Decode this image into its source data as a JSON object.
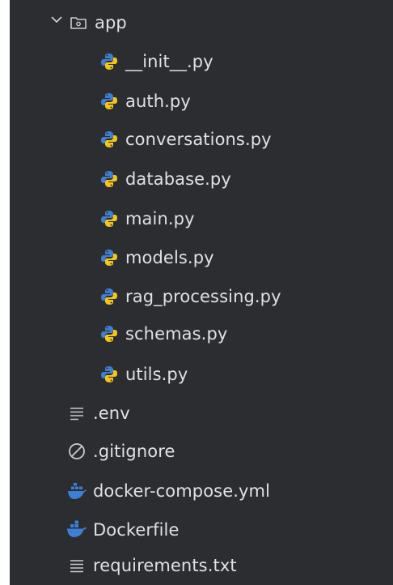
{
  "tree": {
    "folder": {
      "label": "app",
      "icon": "folder-icon",
      "expanded": true,
      "chevron_icon": "chevron-down-icon"
    },
    "app_files": [
      {
        "label": "__init__.py",
        "icon": "python-icon"
      },
      {
        "label": "auth.py",
        "icon": "python-icon"
      },
      {
        "label": "conversations.py",
        "icon": "python-icon"
      },
      {
        "label": "database.py",
        "icon": "python-icon"
      },
      {
        "label": "main.py",
        "icon": "python-icon"
      },
      {
        "label": "models.py",
        "icon": "python-icon"
      },
      {
        "label": "rag_processing.py",
        "icon": "python-icon"
      },
      {
        "label": "schemas.py",
        "icon": "python-icon"
      },
      {
        "label": "utils.py",
        "icon": "python-icon"
      }
    ],
    "root_files": [
      {
        "label": ".env",
        "icon": "text-lines-icon"
      },
      {
        "label": ".gitignore",
        "icon": "ignore-circle-icon"
      },
      {
        "label": "docker-compose.yml",
        "icon": "docker-compose-icon"
      },
      {
        "label": "Dockerfile",
        "icon": "docker-icon"
      },
      {
        "label": "requirements.txt",
        "icon": "text-lines-icon"
      }
    ]
  },
  "colors": {
    "panel_background": "#2b2d30",
    "text": "#dfe1e5",
    "python_blue": "#3d7fd4",
    "python_yellow": "#f5c518",
    "docker_blue": "#3d7fd4",
    "gray_icon": "#c9ccd1"
  }
}
